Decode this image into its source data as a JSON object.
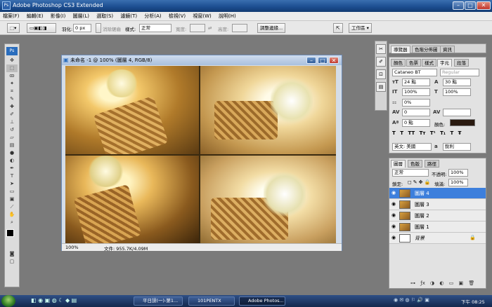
{
  "app": {
    "title": "Adobe Photoshop CS3 Extended",
    "logo": "Ps"
  },
  "menu": [
    "檔案(F)",
    "編輯(E)",
    "影像(I)",
    "圖層(L)",
    "選取(S)",
    "濾鏡(T)",
    "分析(A)",
    "檢視(V)",
    "視窗(W)",
    "說明(H)"
  ],
  "options": {
    "feather_label": "羽化:",
    "feather_value": "0 px",
    "antialias": "消除鋸齒",
    "style_label": "樣式:",
    "style_value": "正常",
    "width_label": "寬度:",
    "height_label": "高度:",
    "refine_button": "調整邊緣...",
    "workspace": "工作區 ▾"
  },
  "document": {
    "title": "未命名 -1 @ 100% (圖層 4, RGB/8)",
    "zoom": "100%",
    "status": "文件: 955.7K/4.09M"
  },
  "nav_tabs": [
    "導覽器",
    "色階分佈圖",
    "資訊"
  ],
  "char_tabs": [
    "顏色",
    "色票",
    "樣式",
    "字元",
    "段落"
  ],
  "character": {
    "font": "Cataneo BT",
    "style": "Regular",
    "size": "24 點",
    "leading": "30 點",
    "vscale": "100%",
    "hscale": "100%",
    "tracking_pct": "0%",
    "kerning": "0",
    "baseline": "0 點",
    "color_label": "顏色:",
    "lang": "英文: 美國",
    "aa_label": "a",
    "aa_value": "銳利",
    "styles": [
      "T",
      "T",
      "TT",
      "Tт",
      "T¹",
      "T₁",
      "T",
      "Ŧ"
    ]
  },
  "layer_tabs": [
    "圖層",
    "色版",
    "路徑"
  ],
  "layers": {
    "mode": "正常",
    "opacity_label": "不透明:",
    "opacity": "100%",
    "lock_label": "鎖定:",
    "fill_label": "填滿:",
    "fill": "100%",
    "items": [
      {
        "name": "圖層 4",
        "selected": true
      },
      {
        "name": "圖層 3",
        "selected": false
      },
      {
        "name": "圖層 2",
        "selected": false
      },
      {
        "name": "圖層 1",
        "selected": false
      },
      {
        "name": "背景",
        "selected": false
      }
    ]
  },
  "taskbar": {
    "items": [
      "平日誤(一)-第1...",
      "101PENTX",
      "Adobe Photos..."
    ],
    "clock": "下午 08:25"
  },
  "colors": {
    "accent": "#3d7fdc",
    "title": "#1d4f92"
  }
}
